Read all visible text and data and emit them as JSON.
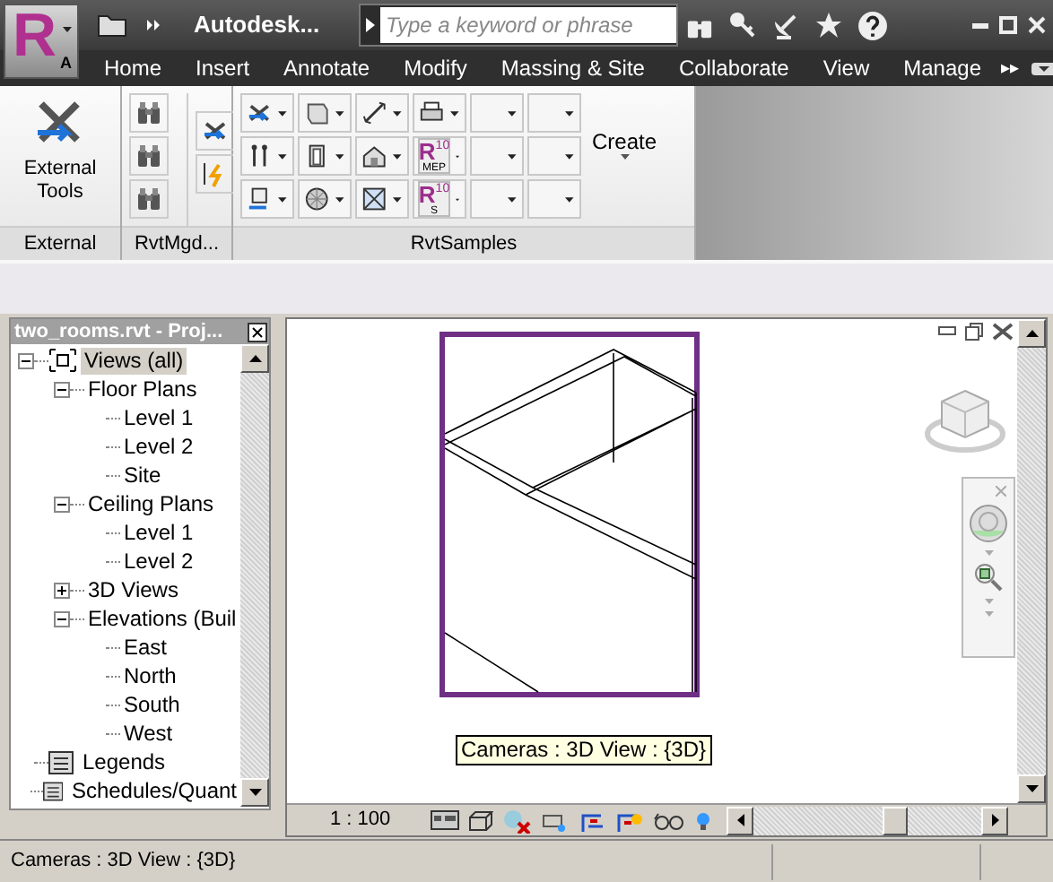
{
  "app_button": {
    "letter": "R",
    "sub": "A"
  },
  "title_bar": {
    "title": "Autodesk...",
    "search": {
      "placeholder": "Type a keyword or phrase"
    }
  },
  "tabs": [
    {
      "label": "Home"
    },
    {
      "label": "Insert"
    },
    {
      "label": "Annotate"
    },
    {
      "label": "Modify"
    },
    {
      "label": "Massing & Site"
    },
    {
      "label": "Collaborate"
    },
    {
      "label": "View"
    },
    {
      "label": "Manage"
    }
  ],
  "tabs_more": "▸▸",
  "ribbon": {
    "panels": [
      {
        "title": "External"
      },
      {
        "title": "RvtMgd..."
      },
      {
        "title": "RvtSamples"
      }
    ],
    "external_tools": "External Tools",
    "create": "Create",
    "grid": [
      {
        "kind": "tool"
      },
      {
        "kind": "tool"
      },
      {
        "kind": "tool"
      },
      {
        "kind": "tool"
      },
      {
        "kind": "empty"
      },
      {
        "kind": "empty"
      },
      {
        "kind": "tool"
      },
      {
        "kind": "tool"
      },
      {
        "kind": "tool"
      },
      {
        "kind": "revit",
        "letter": "R",
        "version": "10",
        "sub": "MEP"
      },
      {
        "kind": "empty"
      },
      {
        "kind": "empty"
      },
      {
        "kind": "tool"
      },
      {
        "kind": "tool"
      },
      {
        "kind": "tool"
      },
      {
        "kind": "revit",
        "letter": "R",
        "version": "10",
        "sub": "S"
      },
      {
        "kind": "empty"
      },
      {
        "kind": "empty"
      }
    ]
  },
  "project_browser": {
    "title": "two_rooms.rvt - Proj...",
    "tree": [
      {
        "label": "Views (all)",
        "selected": true,
        "expanded": true,
        "children": [
          {
            "label": "Floor Plans",
            "selected": false,
            "expanded": true,
            "children": [
              {
                "label": "Level 1",
                "selected": false
              },
              {
                "label": "Level 2",
                "selected": false
              },
              {
                "label": "Site",
                "selected": false
              }
            ]
          },
          {
            "label": "Ceiling Plans",
            "selected": false,
            "expanded": true,
            "children": [
              {
                "label": "Level 1",
                "selected": false
              },
              {
                "label": "Level 2",
                "selected": false
              }
            ]
          },
          {
            "label": "3D Views",
            "selected": false,
            "expanded": false
          },
          {
            "label": "Elevations (Buil",
            "selected": false,
            "expanded": true,
            "children": [
              {
                "label": "East",
                "selected": false
              },
              {
                "label": "North",
                "selected": false
              },
              {
                "label": "South",
                "selected": false
              },
              {
                "label": "West",
                "selected": false
              }
            ]
          }
        ]
      },
      {
        "label": "Legends",
        "selected": false
      },
      {
        "label": "Schedules/Quant",
        "selected": false
      }
    ]
  },
  "view": {
    "tooltip": "Cameras : 3D View : {3D}",
    "scale": "1 : 100"
  },
  "status_bar": {
    "text": "Cameras : 3D View : {3D}"
  }
}
